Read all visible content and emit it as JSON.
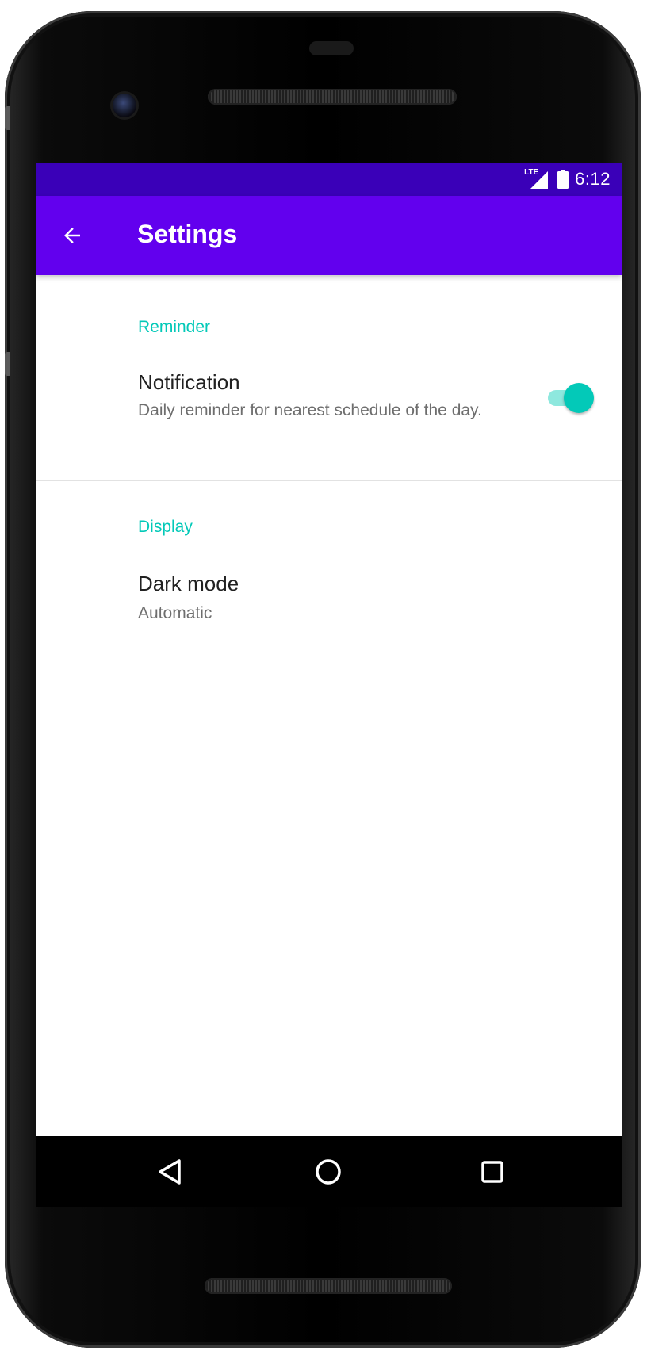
{
  "status_bar": {
    "network": "LTE",
    "time": "6:12",
    "background_color": "#3a00b8"
  },
  "app_bar": {
    "title": "Settings",
    "back_icon": "arrow-back-icon",
    "background_color": "#6200ee"
  },
  "sections": [
    {
      "header": "Reminder",
      "items": [
        {
          "title": "Notification",
          "summary": "Daily reminder for nearest schedule of the day.",
          "switch_on": true
        }
      ]
    },
    {
      "header": "Display",
      "items": [
        {
          "title": "Dark mode",
          "summary": "Automatic"
        }
      ]
    }
  ],
  "nav_bar": {
    "buttons": [
      "back-triangle-icon",
      "home-circle-icon",
      "recents-square-icon"
    ]
  },
  "colors": {
    "accent": "#03c9b8",
    "primary": "#6200ee",
    "primary_dark": "#3a00b8"
  }
}
